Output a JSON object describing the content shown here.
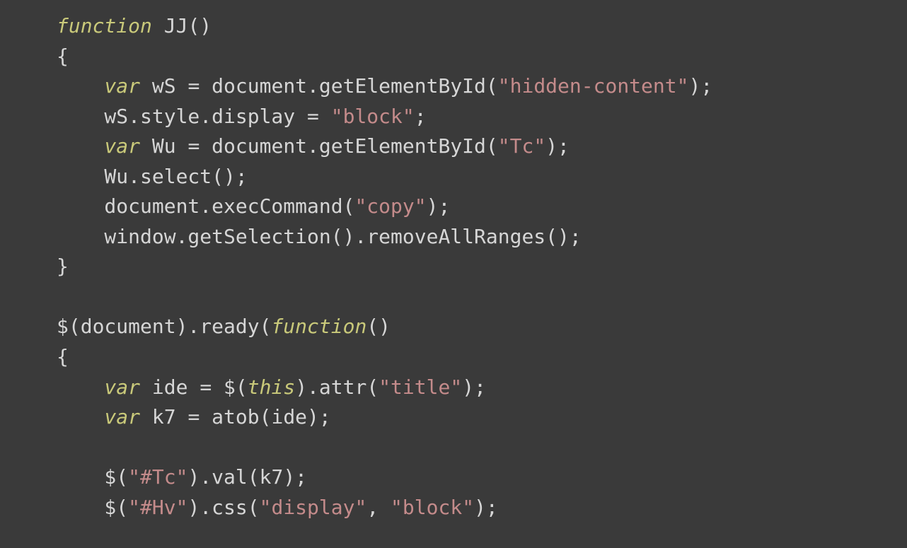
{
  "code": {
    "lines": [
      [
        {
          "cls": "kw",
          "t": "function"
        },
        {
          "cls": "punc",
          "t": " "
        },
        {
          "cls": "fn",
          "t": "JJ"
        },
        {
          "cls": "punc",
          "t": "()"
        }
      ],
      [
        {
          "cls": "punc",
          "t": "{"
        }
      ],
      [
        {
          "cls": "punc",
          "t": "    "
        },
        {
          "cls": "kw",
          "t": "var"
        },
        {
          "cls": "punc",
          "t": " wS "
        },
        {
          "cls": "op",
          "t": "="
        },
        {
          "cls": "punc",
          "t": " document.getElementById("
        },
        {
          "cls": "str",
          "t": "\"hidden-content\""
        },
        {
          "cls": "punc",
          "t": ");"
        }
      ],
      [
        {
          "cls": "punc",
          "t": "    wS.style.display "
        },
        {
          "cls": "op",
          "t": "="
        },
        {
          "cls": "punc",
          "t": " "
        },
        {
          "cls": "str",
          "t": "\"block\""
        },
        {
          "cls": "punc",
          "t": ";"
        }
      ],
      [
        {
          "cls": "punc",
          "t": "    "
        },
        {
          "cls": "kw",
          "t": "var"
        },
        {
          "cls": "punc",
          "t": " Wu "
        },
        {
          "cls": "op",
          "t": "="
        },
        {
          "cls": "punc",
          "t": " document.getElementById("
        },
        {
          "cls": "str",
          "t": "\"Tc\""
        },
        {
          "cls": "punc",
          "t": ");"
        }
      ],
      [
        {
          "cls": "punc",
          "t": "    Wu.select();"
        }
      ],
      [
        {
          "cls": "punc",
          "t": "    document.execCommand("
        },
        {
          "cls": "str",
          "t": "\"copy\""
        },
        {
          "cls": "punc",
          "t": ");"
        }
      ],
      [
        {
          "cls": "punc",
          "t": "    window.getSelection().removeAllRanges();"
        }
      ],
      [
        {
          "cls": "punc",
          "t": "}"
        }
      ],
      [
        {
          "cls": "punc",
          "t": ""
        }
      ],
      [
        {
          "cls": "punc",
          "t": "$(document).ready("
        },
        {
          "cls": "kw",
          "t": "function"
        },
        {
          "cls": "punc",
          "t": "()"
        }
      ],
      [
        {
          "cls": "punc",
          "t": "{"
        }
      ],
      [
        {
          "cls": "punc",
          "t": "    "
        },
        {
          "cls": "kw",
          "t": "var"
        },
        {
          "cls": "punc",
          "t": " ide "
        },
        {
          "cls": "op",
          "t": "="
        },
        {
          "cls": "punc",
          "t": " $("
        },
        {
          "cls": "this",
          "t": "this"
        },
        {
          "cls": "punc",
          "t": ").attr("
        },
        {
          "cls": "str",
          "t": "\"title\""
        },
        {
          "cls": "punc",
          "t": ");"
        }
      ],
      [
        {
          "cls": "punc",
          "t": "    "
        },
        {
          "cls": "kw",
          "t": "var"
        },
        {
          "cls": "punc",
          "t": " k7 "
        },
        {
          "cls": "op",
          "t": "="
        },
        {
          "cls": "punc",
          "t": " atob(ide);"
        }
      ],
      [
        {
          "cls": "punc",
          "t": ""
        }
      ],
      [
        {
          "cls": "punc",
          "t": "    $("
        },
        {
          "cls": "str",
          "t": "\"#Tc\""
        },
        {
          "cls": "punc",
          "t": ").val(k7);"
        }
      ],
      [
        {
          "cls": "punc",
          "t": "    $("
        },
        {
          "cls": "str",
          "t": "\"#Hv\""
        },
        {
          "cls": "punc",
          "t": ").css("
        },
        {
          "cls": "str",
          "t": "\"display\""
        },
        {
          "cls": "punc",
          "t": ", "
        },
        {
          "cls": "str",
          "t": "\"block\""
        },
        {
          "cls": "punc",
          "t": ");"
        }
      ]
    ]
  }
}
